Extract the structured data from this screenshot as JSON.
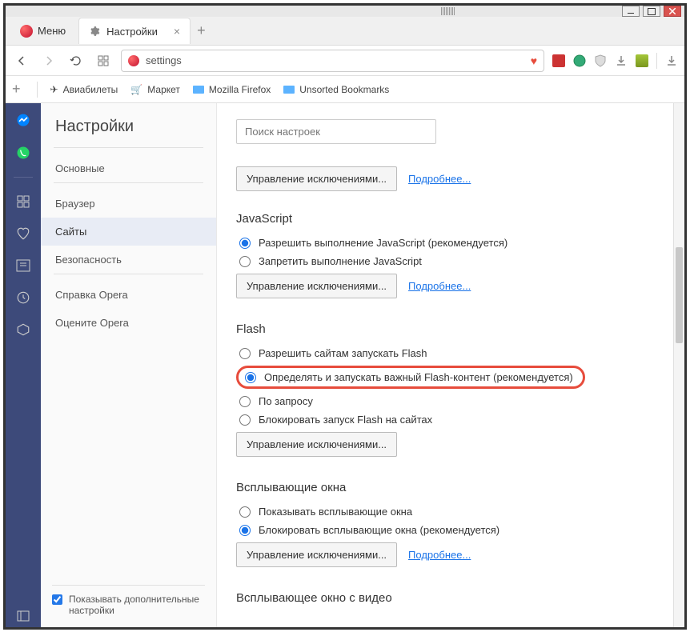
{
  "window": {
    "menu_label": "Меню"
  },
  "tabs": {
    "settings_tab": "Настройки"
  },
  "address": {
    "value": "settings"
  },
  "bookmarks": {
    "item1": "Авиабилеты",
    "item2": "Маркет",
    "item3": "Mozilla Firefox",
    "item4": "Unsorted Bookmarks"
  },
  "settings": {
    "title": "Настройки",
    "nav": {
      "basic": "Основные",
      "browser": "Браузер",
      "sites": "Сайты",
      "security": "Безопасность",
      "help": "Справка Opera",
      "rate": "Оцените Opera"
    },
    "show_advanced": "Показывать дополнительные настройки",
    "search_placeholder": "Поиск настроек",
    "manage_exceptions": "Управление исключениями...",
    "learn_more": "Подробнее...",
    "javascript": {
      "title": "JavaScript",
      "allow": "Разрешить выполнение JavaScript (рекомендуется)",
      "deny": "Запретить выполнение JavaScript"
    },
    "flash": {
      "title": "Flash",
      "allow_all": "Разрешить сайтам запускать Flash",
      "detect": "Определять и запускать важный Flash-контент (рекомендуется)",
      "on_demand": "По запросу",
      "block": "Блокировать запуск Flash на сайтах"
    },
    "popups": {
      "title": "Всплывающие окна",
      "show": "Показывать всплывающие окна",
      "block": "Блокировать всплывающие окна (рекомендуется)"
    },
    "video_popup": {
      "title": "Всплывающее окно с видео"
    }
  }
}
